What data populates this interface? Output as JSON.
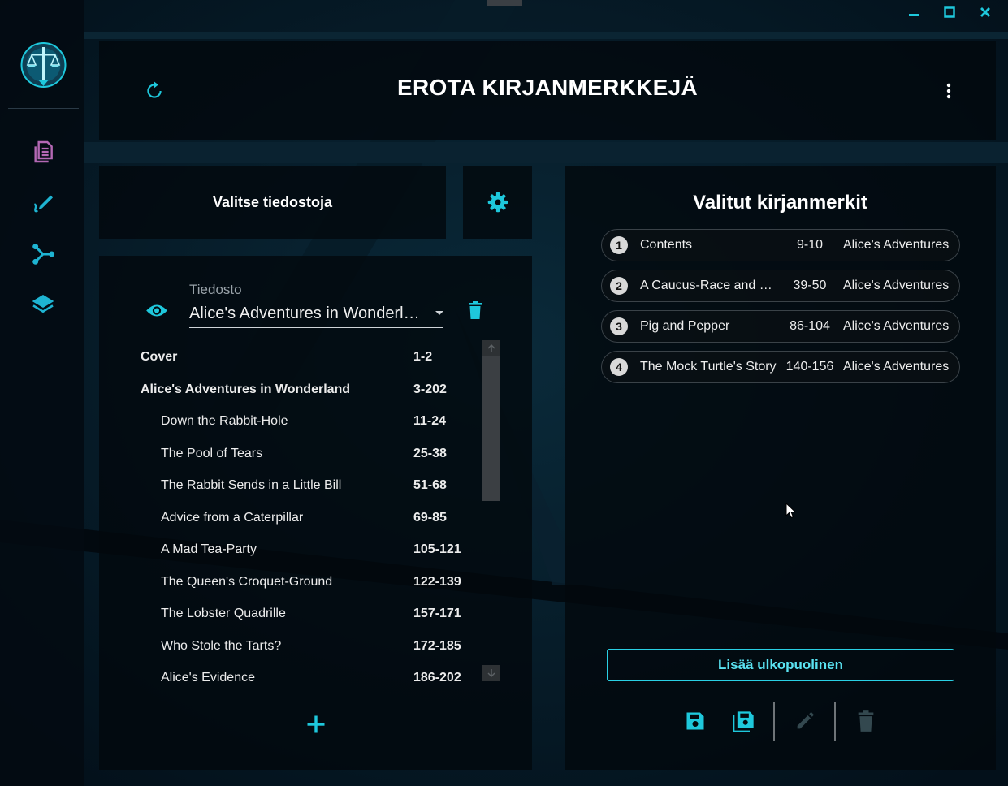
{
  "window": {
    "minimize_icon": "minimize-icon",
    "maximize_icon": "maximize-icon",
    "close_icon": "close-icon",
    "accent": "#1ec8dc"
  },
  "sidebar": {
    "logo_icon": "justice-scales-sword-icon",
    "items": [
      {
        "icon": "document-icon",
        "color": "#b468b4"
      },
      {
        "icon": "edit-pen-icon",
        "color": "#1eb4d2"
      },
      {
        "icon": "split-merge-icon",
        "color": "#1eb4d2"
      },
      {
        "icon": "layers-icon",
        "color": "#1eb4d2"
      }
    ]
  },
  "header": {
    "title": "EROTA KIRJANMERKKEJÄ",
    "reset_icon": "refresh-icon",
    "menu_icon": "more-vert-icon"
  },
  "files": {
    "select_label": "Valitse tiedostoja",
    "settings_icon": "gear-icon",
    "field_label": "Tiedosto",
    "selected_file": "Alice's Adventures in Wonderland",
    "preview_icon": "eye-icon",
    "delete_icon": "trash-icon",
    "add_icon": "plus-icon",
    "bookmarks": [
      {
        "title": "Cover",
        "pages": "1-2",
        "level": 0
      },
      {
        "title": "Alice's Adventures in Wonderland",
        "pages": "3-202",
        "level": 0
      },
      {
        "title": "Down the Rabbit-Hole",
        "pages": "11-24",
        "level": 1
      },
      {
        "title": "The Pool of Tears",
        "pages": "25-38",
        "level": 1
      },
      {
        "title": "The Rabbit Sends in a Little Bill",
        "pages": "51-68",
        "level": 1
      },
      {
        "title": "Advice from a Caterpillar",
        "pages": "69-85",
        "level": 1
      },
      {
        "title": "A Mad Tea-Party",
        "pages": "105-121",
        "level": 1
      },
      {
        "title": "The Queen's Croquet-Ground",
        "pages": "122-139",
        "level": 1
      },
      {
        "title": "The Lobster Quadrille",
        "pages": "157-171",
        "level": 1
      },
      {
        "title": "Who Stole the Tarts?",
        "pages": "172-185",
        "level": 1
      },
      {
        "title": "Alice's Evidence",
        "pages": "186-202",
        "level": 1
      }
    ]
  },
  "selected": {
    "title": "Valitut kirjanmerkit",
    "items": [
      {
        "num": "1",
        "title": "Contents",
        "pages": "9-10",
        "file": "Alice's Adventures"
      },
      {
        "num": "2",
        "title": "A Caucus-Race and a Long Tale",
        "pages": "39-50",
        "file": "Alice's Adventures"
      },
      {
        "num": "3",
        "title": "Pig and Pepper",
        "pages": "86-104",
        "file": "Alice's Adventures"
      },
      {
        "num": "4",
        "title": "The Mock Turtle's Story",
        "pages": "140-156",
        "file": "Alice's Adventures"
      }
    ],
    "add_external_label": "Lisää ulkopuolinen",
    "toolbar": {
      "save_icon": "save-icon",
      "save_all_icon": "save-all-icon",
      "edit_icon": "edit-pencil-icon",
      "delete_icon": "trash-icon"
    }
  }
}
